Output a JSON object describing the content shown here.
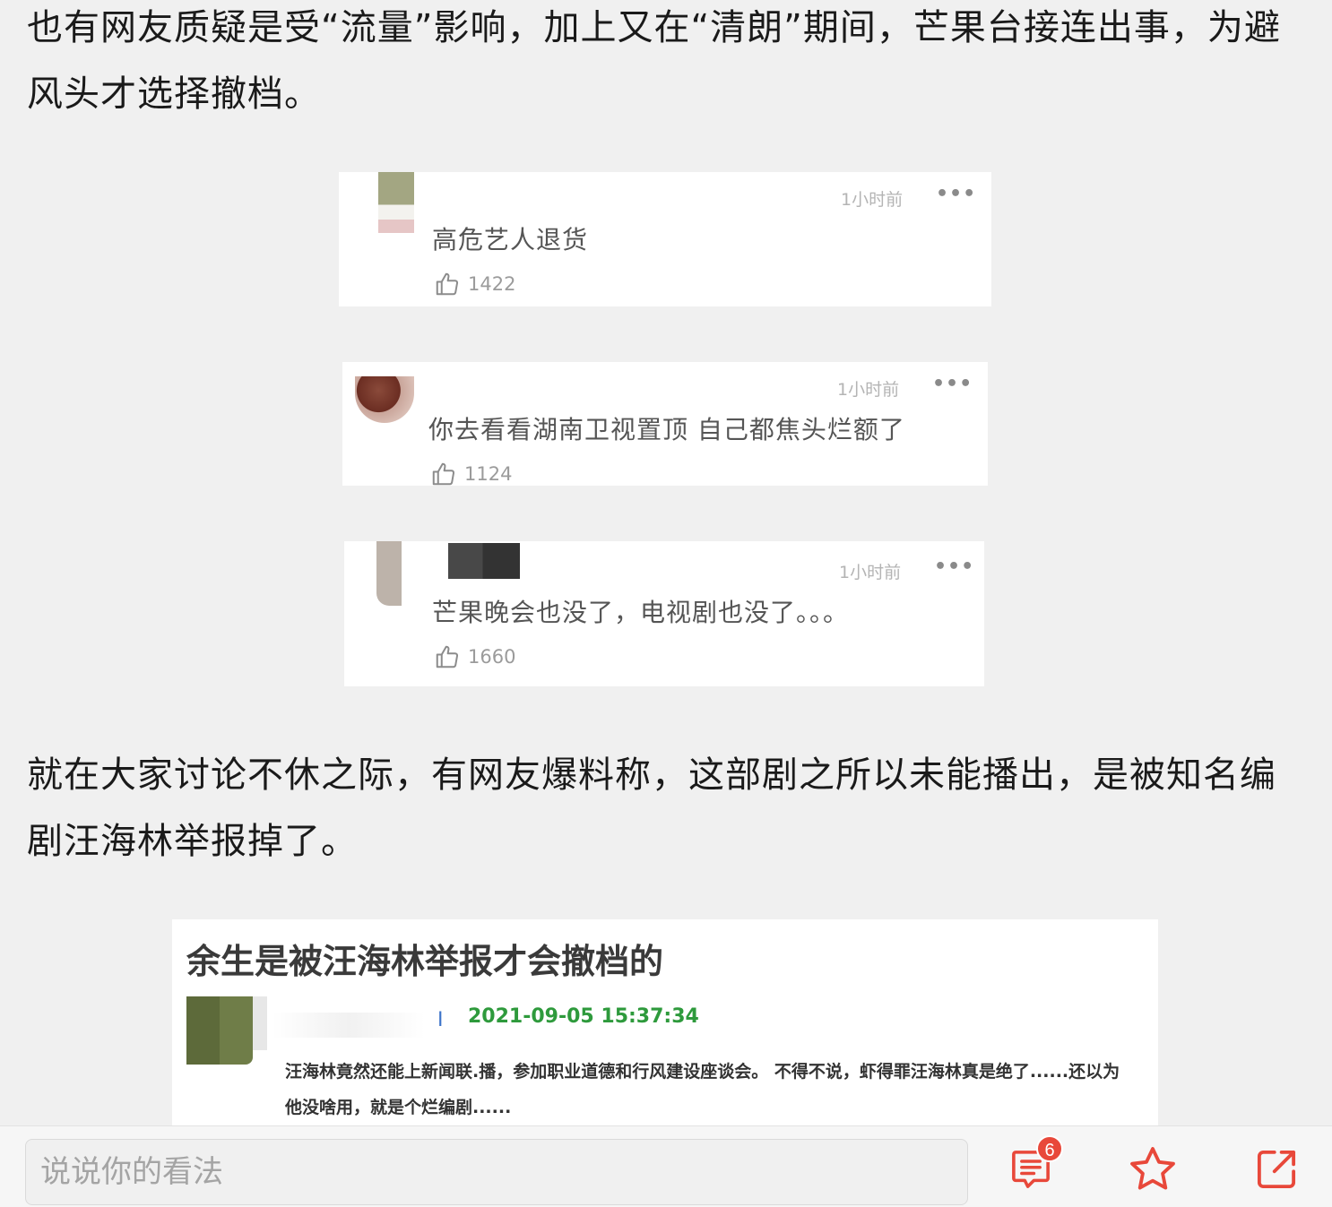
{
  "article": {
    "paragraph1": "也有网友质疑是受“流量”影响，加上又在“清朗”期间，芒果台接连出事，为避风头才选择撤档。",
    "paragraph2": "就在大家讨论不休之际，有网友爆料称，这部剧之所以未能播出，是被知名编剧汪海林举报掉了。"
  },
  "comments": [
    {
      "time": "1小时前",
      "more": "•••",
      "text": "高危艺人退货",
      "likes": "1422"
    },
    {
      "time": "1小时前",
      "more": "•••",
      "text": "你去看看湖南卫视置顶 自己都焦头烂额了",
      "likes": "1124"
    },
    {
      "time": "1小时前",
      "more": "•••",
      "text": "芒果晚会也没了，电视剧也没了。。。",
      "likes": "1660"
    }
  ],
  "forum_post": {
    "title": "余生是被汪海林举报才会撤档的",
    "separator": "I",
    "date": "2021-09-05 15:37:34",
    "body": "汪海林竟然还能上新闻联.播，参加职业道德和行风建设座谈会。 不得不说，虾得罪汪海林真是绝了......还以为他没啥用，就是个烂编剧......"
  },
  "bottom_bar": {
    "input_placeholder": "说说你的看法",
    "comment_count_badge": "6",
    "icons": [
      "comments-icon",
      "star-icon",
      "share-icon"
    ],
    "accent_color": "#e8483a"
  }
}
